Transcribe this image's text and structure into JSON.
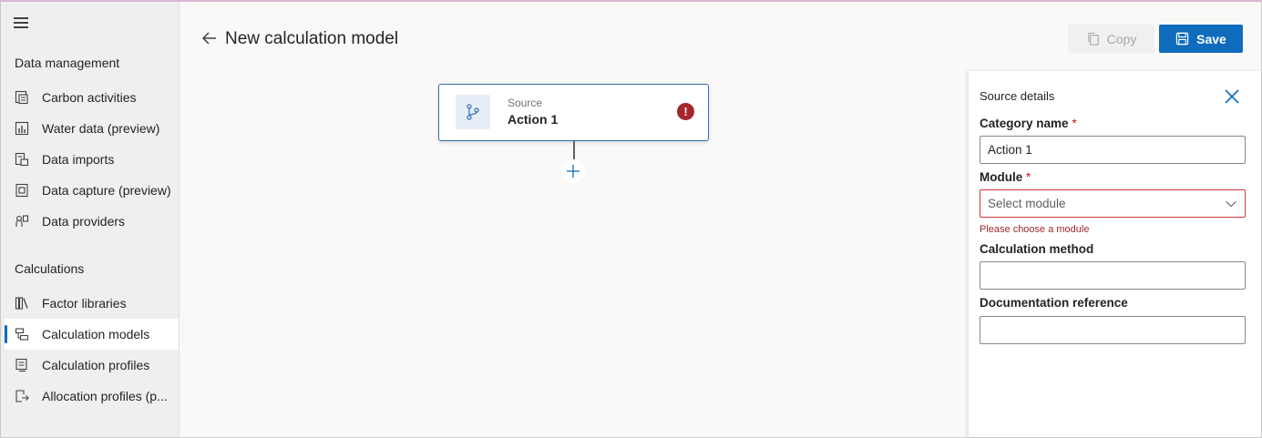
{
  "sidebar": {
    "sections": [
      {
        "title": "Data management"
      },
      {
        "title": "Calculations"
      }
    ],
    "items": [
      {
        "label": "Carbon activities",
        "icon": "carbon-activities-icon"
      },
      {
        "label": "Water data (preview)",
        "icon": "water-data-icon"
      },
      {
        "label": "Data imports",
        "icon": "data-imports-icon"
      },
      {
        "label": "Data capture (preview)",
        "icon": "data-capture-icon"
      },
      {
        "label": "Data providers",
        "icon": "data-providers-icon"
      },
      {
        "label": "Factor libraries",
        "icon": "factor-libraries-icon"
      },
      {
        "label": "Calculation models",
        "icon": "calculation-models-icon",
        "active": true
      },
      {
        "label": "Calculation profiles",
        "icon": "calculation-profiles-icon"
      },
      {
        "label": "Allocation profiles (p...",
        "icon": "allocation-profiles-icon"
      }
    ]
  },
  "header": {
    "title": "New calculation model",
    "copy_label": "Copy",
    "save_label": "Save"
  },
  "canvas": {
    "node": {
      "subtitle": "Source",
      "title": "Action 1",
      "error_glyph": "!"
    }
  },
  "panel": {
    "title": "Source details",
    "category_label": "Category name",
    "category_value": "Action 1",
    "module_label": "Module",
    "module_placeholder": "Select module",
    "module_error": "Please choose a module",
    "method_label": "Calculation method",
    "method_value": "",
    "doc_label": "Documentation reference",
    "doc_value": "",
    "required_marker": "*"
  },
  "colors": {
    "accent": "#0f6cbd",
    "error": "#a4262c",
    "node_border": "#2f6fb7"
  }
}
